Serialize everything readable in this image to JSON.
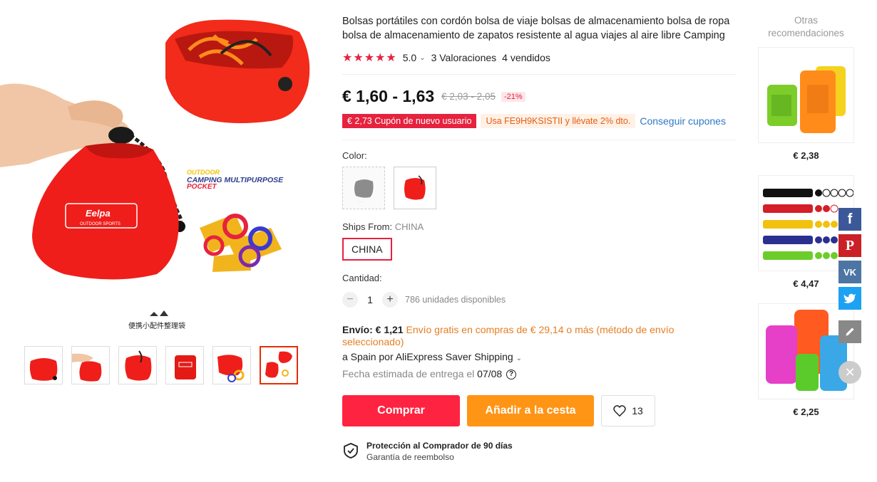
{
  "product": {
    "title": "Bolsas portátiles con cordón bolsa de viaje bolsas de almacenamiento bolsa de ropa bolsa de almacenamiento de zapatos resistente al agua viajes al aire libre Camping",
    "stars": "★★★★★",
    "rating": "5.0",
    "reviews": "3 Valoraciones",
    "sold": "4 vendidos",
    "price": "€ 1,60 - 1,63",
    "old_price": "€ 2,03 - 2,05",
    "discount": "-21%",
    "coupon": "€ 2,73 Cupón de nuevo usuario",
    "code_offer": "Usa FE9H9KSISTII y llévate 2% dto.",
    "get_coupons": "Conseguir cupones",
    "color_label": "Color:",
    "ships_from_label": "Ships From:",
    "ships_from_value": "CHINA",
    "ships_from_option": "CHINA",
    "quantity_label": "Cantidad:",
    "quantity": "1",
    "available": "786 unidades disponibles",
    "shipping_cost": "Envío: € 1,21",
    "shipping_free": "Envío gratis en compras de € 29,14 o más (método de envío seleccionado)",
    "shipping_method": "a Spain por AliExpress Saver Shipping",
    "delivery_label": "Fecha estimada de entrega el",
    "delivery_date": "07/08",
    "buy": "Comprar",
    "add_cart": "Añadir a la cesta",
    "wishlist_count": "13",
    "protection_title": "Protección al Comprador de 90 días",
    "protection_sub": "Garantía de reembolso"
  },
  "gallery": {
    "banner_line1": "OUTDOOR",
    "banner_line2": "CAMPING MULTIPURPOSE",
    "banner_line3": "POCKET",
    "brand": "Eelpa",
    "brand_sub": "OUTDOOR SPORTS",
    "caption": "便携小配件整理袋"
  },
  "recommendations": {
    "title": "Otras recomendaciones",
    "items": [
      {
        "price": "€ 2,38"
      },
      {
        "price": "€ 4,47"
      },
      {
        "price": "€ 2,25"
      }
    ]
  },
  "colors": {
    "accent": "#e6223e",
    "buy": "#ff2342",
    "cart": "#ff9415",
    "link": "#2f78c4"
  }
}
